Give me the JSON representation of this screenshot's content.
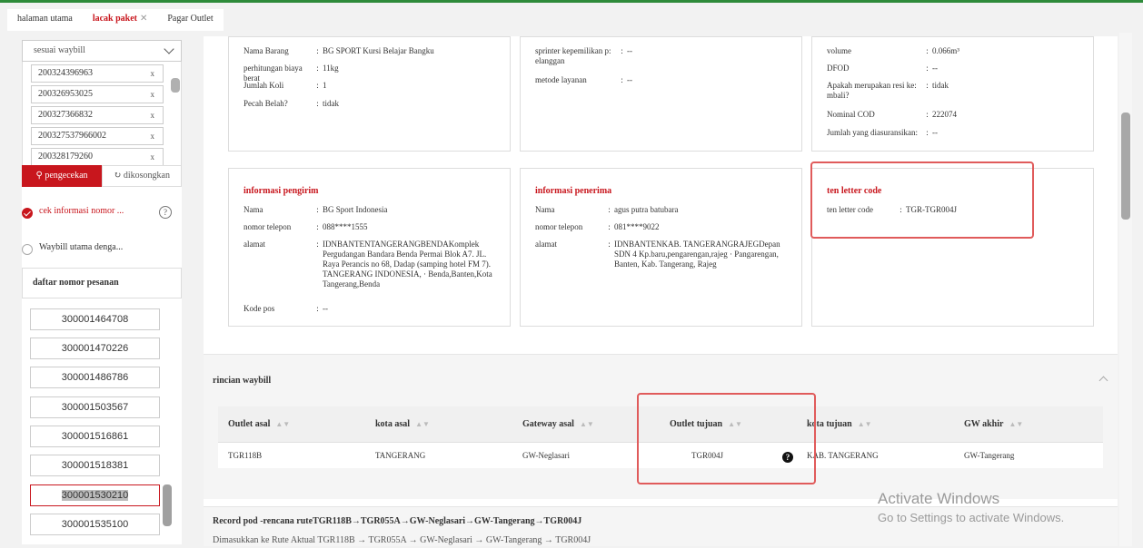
{
  "tabs": [
    {
      "label": "halaman utama"
    },
    {
      "label": "lacak paket"
    },
    {
      "label": "Pagar Outlet"
    }
  ],
  "left": {
    "select_value": "sesuai waybill",
    "waybills": [
      "200324396963",
      "200326953025",
      "200327366832",
      "200327537966002",
      "200328179260"
    ],
    "btn_check": "pengecekan",
    "btn_clear": "dikosongkan",
    "radio1": "cek informasi nomor ...",
    "radio2": "Waybill utama denga...",
    "order_header": "daftar nomor pesanan",
    "orders": [
      "300001464708",
      "300001470226",
      "300001486786",
      "300001503567",
      "300001516861",
      "300001518381",
      "300001530210",
      "300001535100"
    ]
  },
  "card_goods": {
    "rows": [
      {
        "k": "Nama Barang",
        "v": "BG SPORT Kursi Belajar Bangku"
      },
      {
        "k": "perhitungan biaya berat",
        "v": "11kg"
      },
      {
        "k": "Jumlah Koli",
        "v": "1"
      },
      {
        "k": "Pecah Belah?",
        "v": "tidak"
      }
    ]
  },
  "card_service": {
    "rows": [
      {
        "k": "sprinter kepemilikan p: elanggan",
        "v": "--"
      },
      {
        "k": "metode layanan",
        "v": "--"
      }
    ]
  },
  "card_value": {
    "rows": [
      {
        "k": "volume",
        "v": "0.066m³"
      },
      {
        "k": "DFOD",
        "v": "--"
      },
      {
        "k": "Apakah merupakan resi ke: mbali?",
        "v": "tidak"
      },
      {
        "k": "Nominal COD",
        "v": "222074"
      },
      {
        "k": "Jumlah yang diasuransikan:",
        "v": "--"
      }
    ]
  },
  "card_sender": {
    "title": "informasi pengirim",
    "rows": [
      {
        "k": "Nama",
        "v": "BG Sport Indonesia"
      },
      {
        "k": "nomor telepon",
        "v": "088****1555"
      },
      {
        "k": "alamat",
        "v": "IDNBANTENTANGERANGBENDAKomplek Pergudangan Bandara Benda Permai Blok A7. JL. Raya Perancis no 68, Dadap (samping hotel FM 7). TANGERANG INDONESIA, · Benda,Banten,Kota Tangerang,Benda"
      },
      {
        "k": "Kode pos",
        "v": "--"
      }
    ]
  },
  "card_receiver": {
    "title": "informasi penerima",
    "rows": [
      {
        "k": "Nama",
        "v": "agus putra batubara"
      },
      {
        "k": "nomor telepon",
        "v": "081****9022"
      },
      {
        "k": "alamat",
        "v": "IDNBANTENKAB. TANGERANGRAJEGDepan SDN 4 Kp.baru,pengarengan,rajeg · Pangarengan, Banten, Kab. Tangerang, Rajeg"
      }
    ]
  },
  "card_tlc": {
    "title": "ten letter code",
    "rows": [
      {
        "k": "ten letter code",
        "v": "TGR-TGR004J"
      }
    ]
  },
  "waybill_detail": {
    "title": "rincian waybill",
    "columns": [
      "Outlet asal",
      "kota asal",
      "Gateway asal",
      "Outlet tujuan",
      "kota tujuan",
      "GW akhir"
    ],
    "row": [
      "TGR118B",
      "TANGERANG",
      "GW-Neglasari",
      "TGR004J",
      "KAB. TANGERANG",
      "GW-Tangerang"
    ]
  },
  "pod": {
    "title": "Record pod -rencana ruteTGR118B→TGR055A→GW-Neglasari→GW-Tangerang→TGR004J",
    "sub": "Dimasukkan ke Rute Aktual TGR118B → TGR055A → GW-Neglasari → GW-Tangerang → TGR004J"
  },
  "watermark": {
    "line1": "Activate Windows",
    "line2": "Go to Settings to activate Windows."
  },
  "colors": {
    "accent": "#c8161d",
    "highlight": "#e05b5b"
  }
}
